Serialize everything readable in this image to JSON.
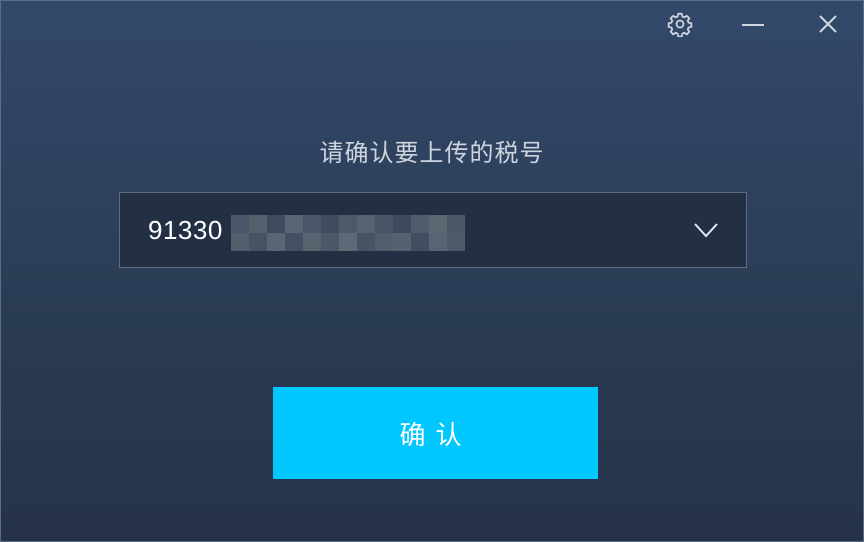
{
  "titlebar": {
    "settings_icon": "gear-icon",
    "minimize_icon": "minimize-icon",
    "close_icon": "close-icon"
  },
  "main": {
    "prompt": "请确认要上传的税号",
    "tax_select": {
      "visible_value": "91330",
      "obscured": true,
      "dropdown_icon": "chevron-down-icon"
    },
    "confirm_label": "确认"
  },
  "colors": {
    "background_top": "#33496a",
    "background_bottom": "#25324a",
    "select_bg": "#233044",
    "accent": "#00c8ff"
  }
}
